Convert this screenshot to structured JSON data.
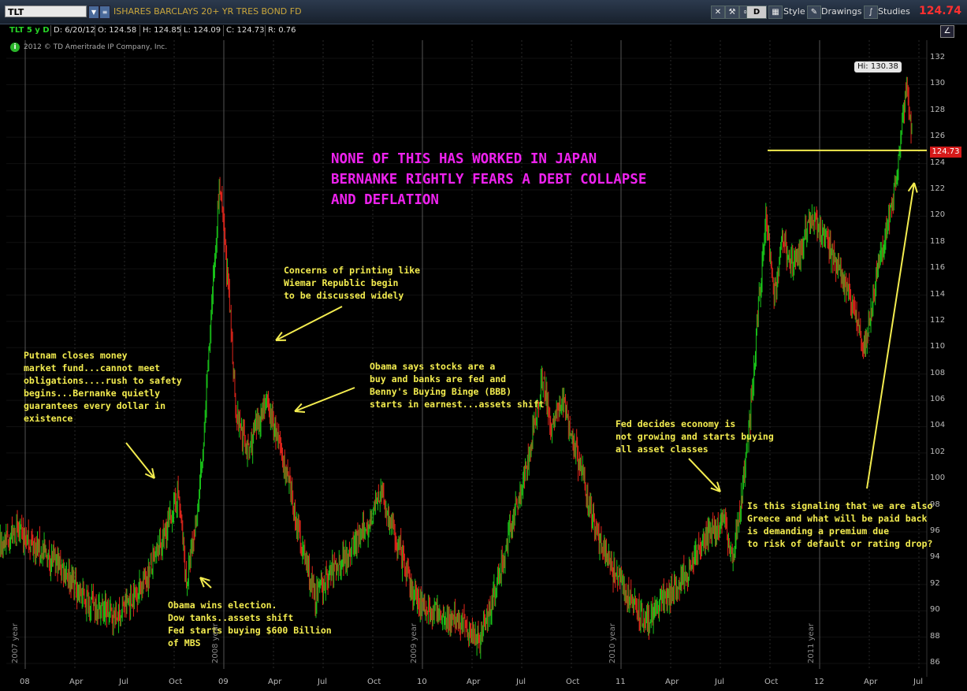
{
  "toolbar": {
    "symbol": "TLT",
    "description": "ISHARES BARCLAYS 20+ YR TRES BOND FD",
    "d_button": "D",
    "style_label": "Style",
    "drawings_label": "Drawings",
    "studies_label": "Studies",
    "last_price": "124.74",
    "last_price_color": "#ff3030"
  },
  "info_bar": {
    "symbol_period": "TLT 5 y D",
    "date": "D: 6/20/12",
    "open": "O: 124.58",
    "high": "H: 124.85",
    "low": "L: 124.09",
    "close": "C: 124.73",
    "range": "R: 0.76"
  },
  "copyright": "2012 © TD Ameritrade IP Company, Inc.",
  "headline": "NONE OF THIS HAS WORKED IN JAPAN\nBERNANKE RIGHTLY FEARS A DEBT COLLAPSE\nAND DEFLATION",
  "headline_color": "#ee22ee",
  "annotations": [
    {
      "id": "putnam",
      "text": "Putnam closes money\nmarket fund...cannot meet\nobligations....rush to safety\nbegins...Bernanke quietly\nguarantees every dollar in\nexistence"
    },
    {
      "id": "obama-election",
      "text": "Obama wins election.\nDow tanks..assets shift\nFed starts buying $600 Billion\nof MBS"
    },
    {
      "id": "weimar",
      "text": "Concerns of printing like\nWiemar Republic begin\nto be discussed widely"
    },
    {
      "id": "obama-stocks",
      "text": "Obama says stocks are a\nbuy and banks are fed and\nBenny's Buying Binge (BBB)\nstarts in earnest...assets shift"
    },
    {
      "id": "fed-decides",
      "text": "Fed decides economy is\nnot growing and starts buying\nall asset classes"
    },
    {
      "id": "greece",
      "text": "Is this signaling that we are also\nGreece and what will be paid back\nis demanding a premium due\nto risk of default or rating drop?"
    }
  ],
  "annotation_color": "#f3ec4f",
  "hi_label": "Hi: 130.38",
  "price_tag": "124.73",
  "y_axis_labels": [
    "132",
    "130",
    "128",
    "126",
    "124",
    "122",
    "120",
    "118",
    "116",
    "114",
    "112",
    "110",
    "108",
    "106",
    "104",
    "102",
    "100",
    "98",
    "96",
    "94",
    "92",
    "90",
    "88",
    "86"
  ],
  "x_axis_labels": [
    "08",
    "Apr",
    "Jul",
    "Oct",
    "09",
    "Apr",
    "Jul",
    "Oct",
    "10",
    "Apr",
    "Jul",
    "Oct",
    "11",
    "Apr",
    "Jul",
    "Oct",
    "12",
    "Apr",
    "Jul"
  ],
  "year_labels": [
    "2007 year",
    "2008 year",
    "2009 year",
    "2010 year",
    "2011 year"
  ],
  "chart_data": {
    "type": "candlestick",
    "title": "ISHARES BARCLAYS 20+ YR TRES BOND FD",
    "ticker": "TLT",
    "ylim": [
      86,
      132
    ],
    "up_color": "#19c419",
    "down_color": "#e0251b",
    "horizontal_line": 125,
    "period_high": 130.38,
    "last_close": 124.73,
    "key_points": [
      {
        "t": "2007 Sep",
        "v": 92
      },
      {
        "t": "2007 Oct",
        "v": 94
      },
      {
        "t": "2007 Dec",
        "v": 96
      },
      {
        "t": "2008 Jan",
        "v": 95
      },
      {
        "t": "2008 Mar",
        "v": 93
      },
      {
        "t": "2008 Apr",
        "v": 91
      },
      {
        "t": "2008 Jun",
        "v": 89.5
      },
      {
        "t": "2008 Jul",
        "v": 91
      },
      {
        "t": "2008 Aug",
        "v": 93
      },
      {
        "t": "2008 Sep",
        "v": 96
      },
      {
        "t": "2008 Oct",
        "v": 99
      },
      {
        "t": "2008 Oct",
        "v": 92
      },
      {
        "t": "2008 Nov",
        "v": 96
      },
      {
        "t": "2008 Nov",
        "v": 102
      },
      {
        "t": "2008 Dec",
        "v": 113
      },
      {
        "t": "2008 Dec",
        "v": 122.5
      },
      {
        "t": "2009 Jan",
        "v": 115
      },
      {
        "t": "2009 Jan",
        "v": 105
      },
      {
        "t": "2009 Feb",
        "v": 102
      },
      {
        "t": "2009 Mar",
        "v": 106
      },
      {
        "t": "2009 Apr",
        "v": 102
      },
      {
        "t": "2009 May",
        "v": 96
      },
      {
        "t": "2009 Jun",
        "v": 91
      },
      {
        "t": "2009 Jul",
        "v": 93
      },
      {
        "t": "2009 Sep",
        "v": 96
      },
      {
        "t": "2009 Oct",
        "v": 99
      },
      {
        "t": "2009 Nov",
        "v": 95
      },
      {
        "t": "2009 Dec",
        "v": 91
      },
      {
        "t": "2010 Jan",
        "v": 90
      },
      {
        "t": "2010 Mar",
        "v": 89
      },
      {
        "t": "2010 Apr",
        "v": 88
      },
      {
        "t": "2010 May",
        "v": 92
      },
      {
        "t": "2010 Jun",
        "v": 97
      },
      {
        "t": "2010 Jul",
        "v": 102
      },
      {
        "t": "2010 Aug",
        "v": 108
      },
      {
        "t": "2010 Aug",
        "v": 104
      },
      {
        "t": "2010 Sep",
        "v": 106
      },
      {
        "t": "2010 Oct",
        "v": 101
      },
      {
        "t": "2010 Nov",
        "v": 96
      },
      {
        "t": "2010 Dec",
        "v": 93
      },
      {
        "t": "2011 Jan",
        "v": 91
      },
      {
        "t": "2011 Feb",
        "v": 89
      },
      {
        "t": "2011 Mar",
        "v": 91
      },
      {
        "t": "2011 Apr",
        "v": 92
      },
      {
        "t": "2011 May",
        "v": 94
      },
      {
        "t": "2011 Jun",
        "v": 96
      },
      {
        "t": "2011 Jul",
        "v": 97
      },
      {
        "t": "2011 Jul",
        "v": 94
      },
      {
        "t": "2011 Aug",
        "v": 98
      },
      {
        "t": "2011 Aug",
        "v": 104
      },
      {
        "t": "2011 Sep",
        "v": 112
      },
      {
        "t": "2011 Sep",
        "v": 120
      },
      {
        "t": "2011 Oct",
        "v": 114
      },
      {
        "t": "2011 Oct",
        "v": 118
      },
      {
        "t": "2011 Nov",
        "v": 116
      },
      {
        "t": "2011 Dec",
        "v": 120
      },
      {
        "t": "2012 Jan",
        "v": 118
      },
      {
        "t": "2012 Feb",
        "v": 115
      },
      {
        "t": "2012 Mar",
        "v": 112
      },
      {
        "t": "2012 Mar",
        "v": 110
      },
      {
        "t": "2012 Apr",
        "v": 116
      },
      {
        "t": "2012 May",
        "v": 120
      },
      {
        "t": "2012 May",
        "v": 124
      },
      {
        "t": "2012 Jun",
        "v": 130
      },
      {
        "t": "2012 Jun",
        "v": 124.7
      }
    ]
  }
}
